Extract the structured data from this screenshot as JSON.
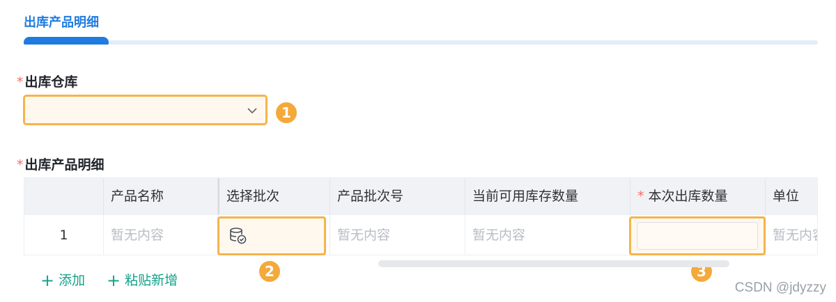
{
  "tab": {
    "title": "出库产品明细"
  },
  "warehouse": {
    "label": "出库仓库",
    "required_mark": "*",
    "value": ""
  },
  "markers": {
    "m1": "1",
    "m2": "2",
    "m3": "3"
  },
  "details": {
    "label": "出库产品明细",
    "required_mark": "*"
  },
  "table": {
    "headers": {
      "index": "",
      "product_name": "产品名称",
      "select_batch": "选择批次",
      "batch_no": "产品批次号",
      "available_stock": "当前可用库存数量",
      "outbound_qty_required": "*",
      "outbound_qty": "本次出库数量",
      "unit": "单位"
    },
    "rows": [
      {
        "index": "1",
        "product_name": "暂无内容",
        "batch_icon": "database-check-icon",
        "batch_no": "暂无内容",
        "available_stock": "暂无内容",
        "outbound_qty": "",
        "unit": "暂无内容"
      }
    ]
  },
  "actions": {
    "add": "添加",
    "paste_add": "粘贴新增"
  },
  "watermark": "CSDN @jdyzzy",
  "colors": {
    "accent": "#1f7be0",
    "highlight": "#f5b44b",
    "action": "#13a38a",
    "required": "#f56c6c"
  }
}
